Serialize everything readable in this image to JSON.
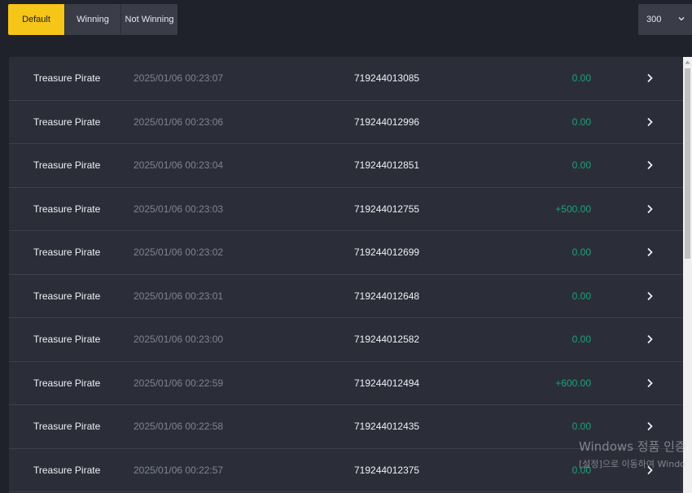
{
  "filters": {
    "default_label": "Default",
    "winning_label": "Winning",
    "not_winning_label": "Not Winning",
    "active": "Default",
    "active_color": "#f5c518"
  },
  "page_size": {
    "value": "300",
    "icon": "chevron-down-icon"
  },
  "rows": [
    {
      "game": "Treasure Pirate",
      "time": "2025/01/06 00:23:07",
      "id": "719244013085",
      "amount": "0.00"
    },
    {
      "game": "Treasure Pirate",
      "time": "2025/01/06 00:23:06",
      "id": "719244012996",
      "amount": "0.00"
    },
    {
      "game": "Treasure Pirate",
      "time": "2025/01/06 00:23:04",
      "id": "719244012851",
      "amount": "0.00"
    },
    {
      "game": "Treasure Pirate",
      "time": "2025/01/06 00:23:03",
      "id": "719244012755",
      "amount": "+500.00"
    },
    {
      "game": "Treasure Pirate",
      "time": "2025/01/06 00:23:02",
      "id": "719244012699",
      "amount": "0.00"
    },
    {
      "game": "Treasure Pirate",
      "time": "2025/01/06 00:23:01",
      "id": "719244012648",
      "amount": "0.00"
    },
    {
      "game": "Treasure Pirate",
      "time": "2025/01/06 00:23:00",
      "id": "719244012582",
      "amount": "0.00"
    },
    {
      "game": "Treasure Pirate",
      "time": "2025/01/06 00:22:59",
      "id": "719244012494",
      "amount": "+600.00"
    },
    {
      "game": "Treasure Pirate",
      "time": "2025/01/06 00:22:58",
      "id": "719244012435",
      "amount": "0.00"
    },
    {
      "game": "Treasure Pirate",
      "time": "2025/01/06 00:22:57",
      "id": "719244012375",
      "amount": "0.00"
    }
  ],
  "amount_color": "#1aa37a",
  "row_icon": "chevron-right-icon",
  "watermark": {
    "line1": "Windows 정품 인증",
    "line2": "[설정]으로 이동하여 Windo"
  }
}
